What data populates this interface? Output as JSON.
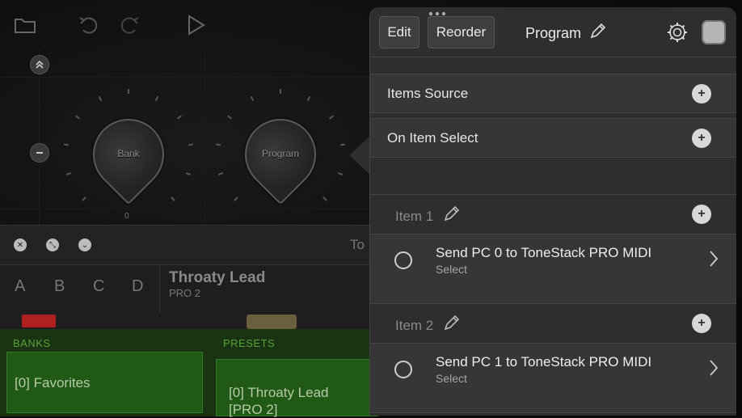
{
  "toolbar": {
    "icons": [
      "folder-icon",
      "undo-icon",
      "redo-icon",
      "play-icon"
    ]
  },
  "canvas": {
    "knobs": [
      {
        "label": "Bank"
      },
      {
        "label": "Program"
      }
    ],
    "knob_value": "0"
  },
  "lower_panel": {
    "title_partial": "To",
    "letters": [
      "A",
      "B",
      "C",
      "D"
    ],
    "preset_name": "Throaty Lead",
    "preset_device": "PRO 2",
    "banks_label": "BANKS",
    "presets_label": "PRESETS",
    "bank_item": "[0] Favorites",
    "preset_item_line1": "[0] Throaty Lead",
    "preset_item_line2": "[PRO 2]"
  },
  "panel": {
    "edit_label": "Edit",
    "reorder_label": "Reorder",
    "title": "Program",
    "items_source_label": "Items Source",
    "on_item_select_label": "On Item Select",
    "items": [
      {
        "header": "Item 1",
        "action": "Send PC 0 to ToneStack PRO MIDI",
        "sub": "Select"
      },
      {
        "header": "Item 2",
        "action": "Send PC 1 to ToneStack PRO MIDI",
        "sub": "Select"
      }
    ]
  },
  "colors": {
    "panel_bg": "#2e2e2e",
    "green": "#215a16",
    "green_text": "#59a23a"
  }
}
